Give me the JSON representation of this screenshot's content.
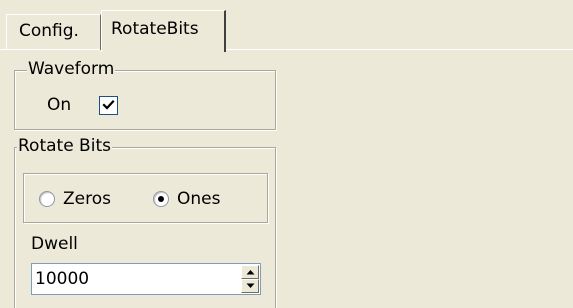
{
  "tabs": [
    {
      "label": "Config.",
      "selected": false
    },
    {
      "label": "RotateBits",
      "selected": true
    }
  ],
  "waveform": {
    "title": "Waveform",
    "on_label": "On",
    "on_checked": true
  },
  "rotate_bits": {
    "title": "Rotate Bits",
    "options": [
      {
        "label": "Zeros",
        "selected": false
      },
      {
        "label": "Ones",
        "selected": true
      }
    ],
    "dwell_label": "Dwell",
    "dwell_value": "10000"
  },
  "icons": {
    "checkmark": "checkmark-icon",
    "spin_up": "arrow-up-icon",
    "spin_down": "arrow-down-icon"
  },
  "colors": {
    "background": "#ece9d8",
    "groupbox_border": "#aca899",
    "input_border": "#7f9db9"
  }
}
